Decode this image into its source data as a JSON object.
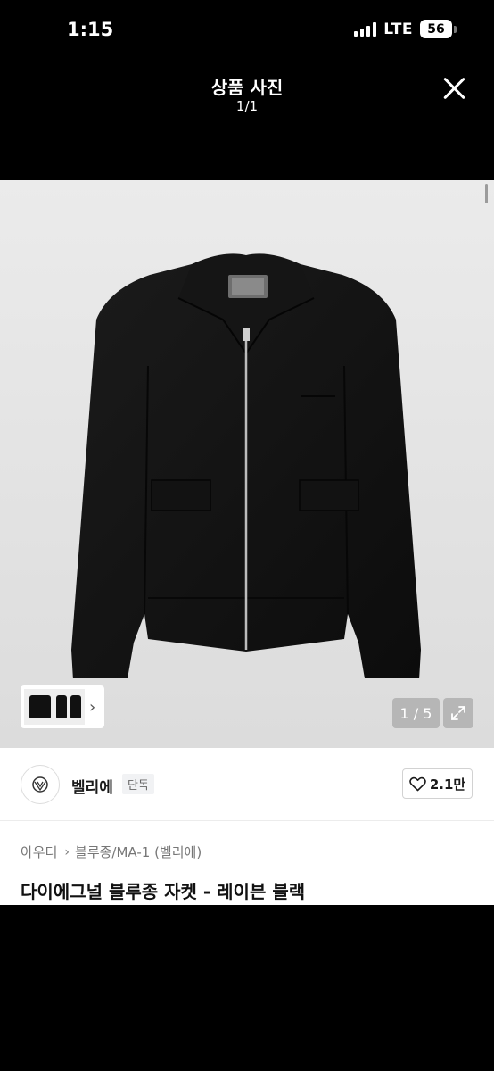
{
  "status_bar": {
    "time": "1:15",
    "network": "LTE",
    "battery": "56",
    "icons": [
      "signal-icon",
      "battery-icon"
    ]
  },
  "header": {
    "title": "상품 사진",
    "counter": "1/1",
    "close_icon": "close-icon"
  },
  "gallery": {
    "page_indicator": "1 / 5",
    "thumbnail_chevron": "›",
    "icons": [
      "expand-icon",
      "chevron-right-icon"
    ]
  },
  "seller": {
    "name": "벨리에",
    "badge": "단독",
    "like_count": "2.1만",
    "icons": [
      "brand-logo-icon",
      "heart-icon"
    ]
  },
  "product": {
    "breadcrumb": [
      "아우터",
      "블루종/MA-1 (벨리에)"
    ],
    "title": "다이에그널 블루종 자켓 - 레이븐 블랙"
  },
  "colors": {
    "background": "#000000",
    "gallery_bg": "#e4e4e4",
    "jacket": "#111111",
    "badge_bg": "#f1f2f4"
  }
}
